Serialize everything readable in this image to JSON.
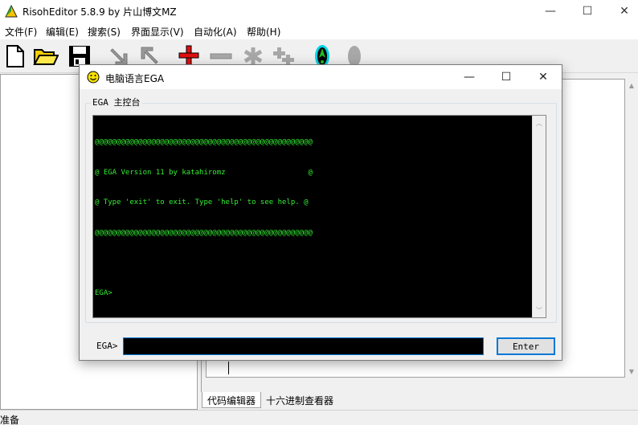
{
  "app": {
    "title": "RisohEditor 5.8.9 by 片山博文MZ",
    "minimize": "—",
    "maximize": "☐",
    "close": "✕"
  },
  "menu": [
    {
      "label": "文件(F)"
    },
    {
      "label": "编辑(E)"
    },
    {
      "label": "搜索(S)"
    },
    {
      "label": "界面显示(V)"
    },
    {
      "label": "自动化(A)"
    },
    {
      "label": "帮助(H)"
    }
  ],
  "toolbar": {
    "icons": [
      "new-file-icon",
      "open-folder-icon",
      "save-icon",
      "move-down-icon",
      "move-up-icon",
      "add-icon",
      "remove-icon",
      "asterisk-icon",
      "copy-icon",
      "test-run-icon",
      "gray-bullet-icon"
    ]
  },
  "tabs": [
    {
      "label": "代码编辑器"
    },
    {
      "label": "十六进制查看器"
    }
  ],
  "status": {
    "text": "准备"
  },
  "dialog": {
    "title": "电脑语言EGA",
    "group_label": "EGA 主控台",
    "console_lines": [
      "@@@@@@@@@@@@@@@@@@@@@@@@@@@@@@@@@@@@@@@@@@@@@@@@@@",
      "@ EGA Version 11 by katahiromz                   @",
      "@ Type 'exit' to exit. Type 'help' to see help. @",
      "@@@@@@@@@@@@@@@@@@@@@@@@@@@@@@@@@@@@@@@@@@@@@@@@@@",
      "",
      "EGA>"
    ],
    "prompt_label": "EGA>",
    "input_value": "",
    "enter_label": "Enter",
    "minimize": "—",
    "maximize": "☐",
    "close": "✕"
  },
  "colors": {
    "console_bg": "#000000",
    "console_text": "#33ee33",
    "accent": "#0078d7"
  }
}
